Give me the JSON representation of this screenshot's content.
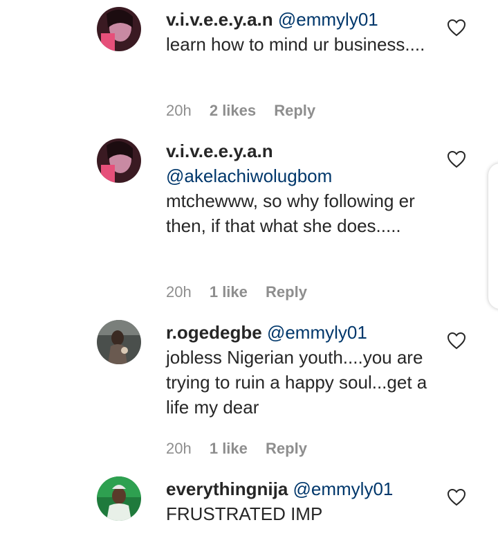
{
  "comments": [
    {
      "username": "v.i.v.e.e.y.a.n",
      "mention": "@emmyly01",
      "text": "learn how to mind ur business....",
      "time": "20h",
      "likes": "2 likes",
      "reply": "Reply"
    },
    {
      "username": "v.i.v.e.e.y.a.n",
      "mention": "@akelachiwolugbom",
      "text": "mtchewww, so why following er then, if that what she does.....",
      "time": "20h",
      "likes": "1 like",
      "reply": "Reply"
    },
    {
      "username": "r.ogedegbe",
      "mention": "@emmyly01",
      "text": "jobless Nigerian youth....you are trying to ruin a happy soul...get a life my dear",
      "time": "20h",
      "likes": "1 like",
      "reply": "Reply"
    },
    {
      "username": "everythingnija",
      "mention": "@emmyly01",
      "text": "FRUSTRATED IMP"
    }
  ],
  "icons": {
    "like": "heart-outline-icon"
  },
  "colors": {
    "text": "#262626",
    "mention": "#00376b",
    "meta": "#8e8e8e"
  }
}
